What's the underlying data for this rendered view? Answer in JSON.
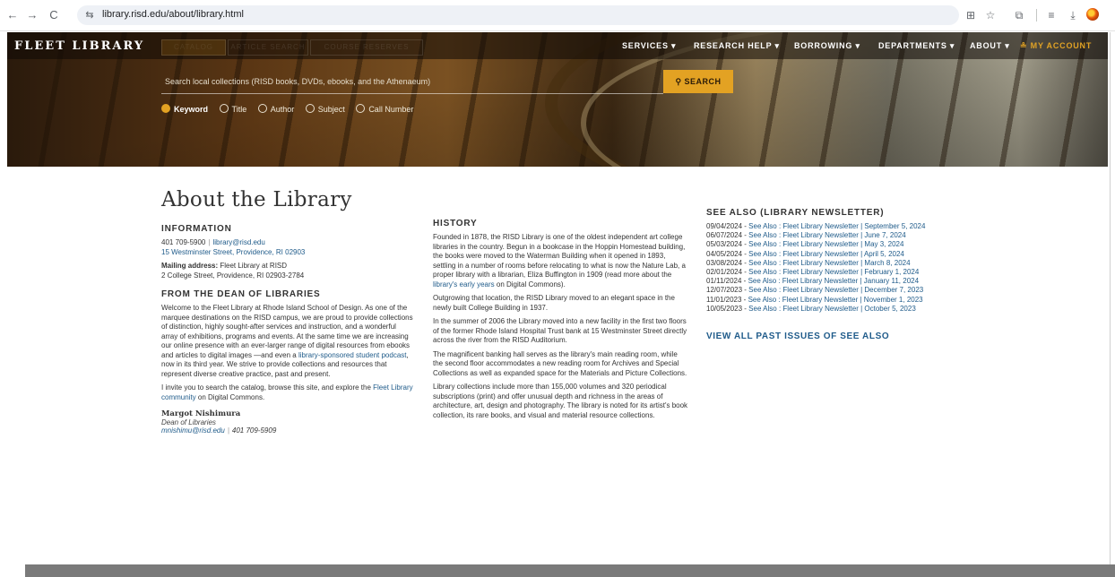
{
  "browser": {
    "url": "library.risd.edu/about/library.html",
    "back_icon": "←",
    "forward_icon": "→",
    "reload_icon": "C",
    "site_info_icon": "⇆",
    "translate_icon": "⊞",
    "star_icon": "☆",
    "extensions_icon": "⧉",
    "tabsearch_icon": "≡",
    "download_icon": "⤓"
  },
  "header": {
    "logo": "FLEET LIBRARY",
    "search_tabs": [
      "CATALOG",
      "ARTICLE SEARCH",
      "COURSE RESERVES"
    ],
    "nav": [
      "SERVICES ▾",
      "RESEARCH HELP ▾",
      "BORROWING ▾",
      "DEPARTMENTS ▾",
      "ABOUT ▾"
    ],
    "account": "≗ MY ACCOUNT",
    "search_placeholder": "Search local collections (RISD books, DVDs, ebooks, and the Athenaeum)",
    "search_button": "⚲ SEARCH",
    "radios": [
      "Keyword",
      "Title",
      "Author",
      "Subject",
      "Call Number"
    ],
    "selected_radio": "Keyword"
  },
  "about": {
    "title": "About the Library",
    "info_heading": "INFORMATION",
    "phone": "401 709-5900",
    "email": "library@risd.edu",
    "address": "15 Westminster Street, Providence, RI 02903",
    "mailing_label": "Mailing address:",
    "mailing_text": " Fleet Library at RISD",
    "mailing_line2": "2 College Street, Providence, RI 02903-2784",
    "dean_heading": "FROM THE DEAN OF LIBRARIES",
    "dean_p1_a": "Welcome to the Fleet Library at Rhode Island School of Design. As one of the marquee destinations on the RISD campus, we are proud to provide collections of distinction, highly sought-after services and instruction, and a wonderful array of exhibitions, programs and events. At the same time we are increasing our online presence with an ever-larger range of digital resources from ebooks and articles to digital images —and even a ",
    "dean_p1_link": "library-sponsored student podcast",
    "dean_p1_b": ", now in its third year. We strive to provide collections and resources that represent diverse creative practice, past and present.",
    "dean_p2_a": "I invite you to search the catalog, browse this site, and explore the ",
    "dean_p2_link": "Fleet Library community",
    "dean_p2_b": " on Digital Commons.",
    "sig_name": "Margot Nishimura",
    "sig_title": "Dean of Libraries",
    "sig_email": "mnishimu@risd.edu",
    "sig_phone": "401 709-5909"
  },
  "history": {
    "heading": "HISTORY",
    "p1_a": "Founded in 1878, the RISD Library is one of the oldest independent art college libraries in the country. Begun in a bookcase in the Hoppin Homestead building, the books were moved to the Waterman Building when it opened in 1893, settling in a number of rooms before relocating to what is now the Nature Lab, a proper library with a librarian, Eliza Buffington in 1909 (read more about the ",
    "p1_link": "library's early years",
    "p1_b": " on Digital Commons).",
    "p2": "Outgrowing that location, the RISD Library moved to an elegant space in the newly built College Building in 1937.",
    "p3": "In the summer of 2006 the Library moved into a new facility in the first two floors of the former Rhode Island Hospital Trust bank at 15 Westminster Street directly across the river from the RISD Auditorium.",
    "p4": "The magnificent banking hall serves as the library's main reading room, while the second floor accommodates a new reading room for Archives and Special Collections as well as expanded space for the Materials and Picture Collections.",
    "p5": "Library collections include more than 155,000 volumes and 320 periodical subscriptions (print) and offer unusual depth and richness in the areas of architecture, art, design and photography. The library is noted for its artist's book collection, its rare books, and visual and material resource collections."
  },
  "newsletter": {
    "heading": "SEE ALSO (LIBRARY NEWSLETTER)",
    "items": [
      {
        "date": "09/04/2024 - ",
        "link": "See Also : Fleet Library Newsletter | September 5, 2024"
      },
      {
        "date": "06/07/2024 - ",
        "link": "See Also : Fleet Library Newsletter | June 7, 2024"
      },
      {
        "date": "05/03/2024 - ",
        "link": "See Also : Fleet Library Newsletter | May 3, 2024"
      },
      {
        "date": "04/05/2024 - ",
        "link": "See Also : Fleet Library Newsletter | April 5, 2024"
      },
      {
        "date": "03/08/2024 - ",
        "link": "See Also : Fleet Library Newsletter | March 8, 2024"
      },
      {
        "date": "02/01/2024 - ",
        "link": "See Also : Fleet Library Newsletter | February 1, 2024"
      },
      {
        "date": "01/11/2024 - ",
        "link": "See Also : Fleet Library Newsletter | January 11, 2024"
      },
      {
        "date": "12/07/2023 - ",
        "link": "See Also : Fleet Library Newsletter | December 7, 2023"
      },
      {
        "date": "11/01/2023 - ",
        "link": "See Also : Fleet Library Newsletter | November 1, 2023"
      },
      {
        "date": "10/05/2023 - ",
        "link": "See Also : Fleet Library Newsletter | October 5, 2023"
      }
    ],
    "view_all": "VIEW ALL PAST ISSUES OF SEE ALSO"
  },
  "colors": {
    "accent": "#e3a223",
    "link": "#1f5b8a"
  }
}
